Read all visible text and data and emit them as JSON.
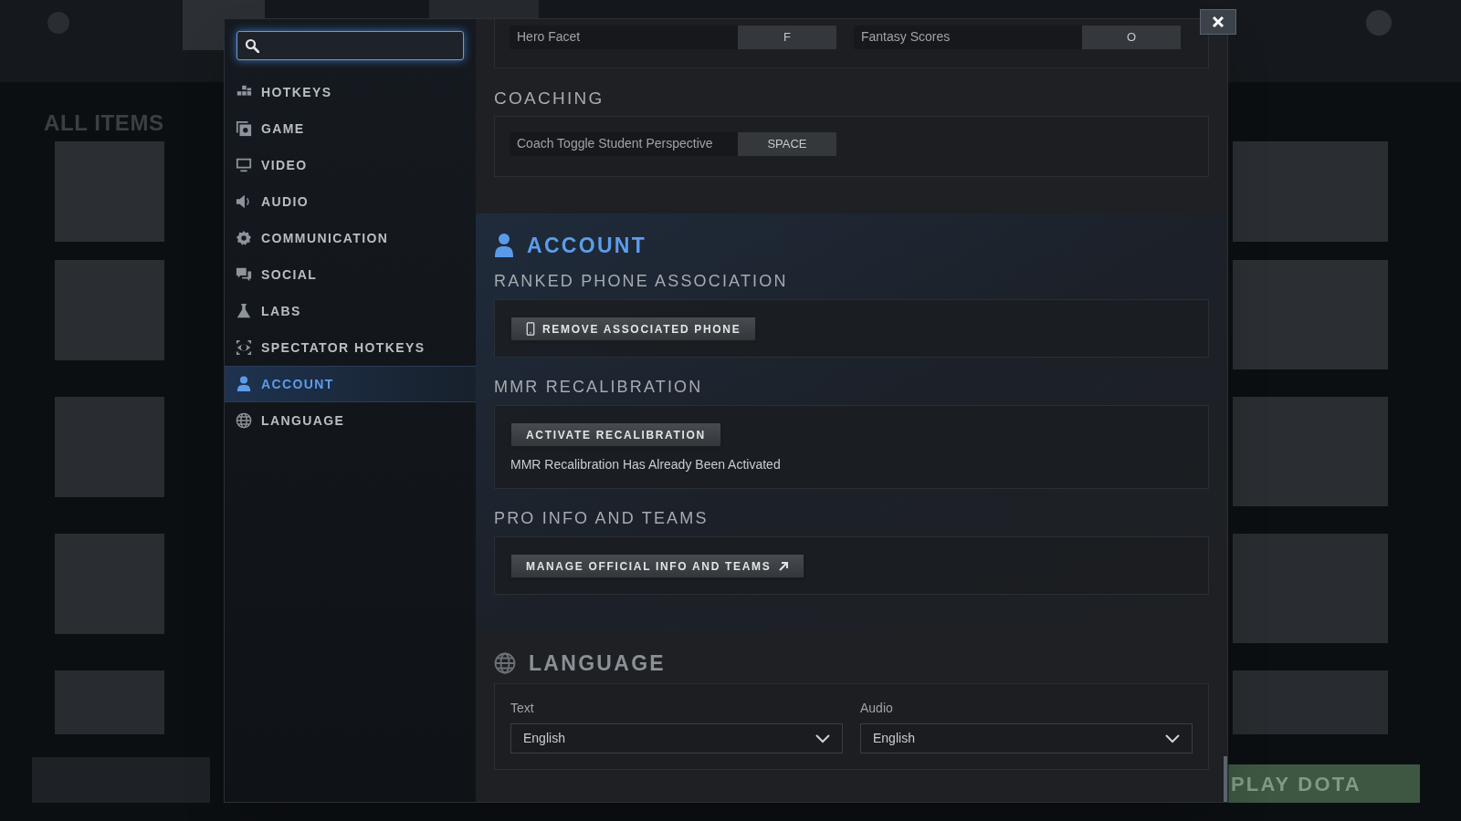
{
  "background": {
    "heading": "ALL ITEMS",
    "play_button": "PLAY DOTA"
  },
  "sidebar": {
    "items": [
      {
        "label": "HOTKEYS",
        "selected": false
      },
      {
        "label": "GAME",
        "selected": false
      },
      {
        "label": "VIDEO",
        "selected": false
      },
      {
        "label": "AUDIO",
        "selected": false
      },
      {
        "label": "COMMUNICATION",
        "selected": false
      },
      {
        "label": "SOCIAL",
        "selected": false
      },
      {
        "label": "LABS",
        "selected": false
      },
      {
        "label": "SPECTATOR HOTKEYS",
        "selected": false
      },
      {
        "label": "ACCOUNT",
        "selected": true
      },
      {
        "label": "LANGUAGE",
        "selected": false
      }
    ]
  },
  "hotkeys": {
    "rows": [
      {
        "label": "Hero Facet",
        "key": "F"
      },
      {
        "label": "Fantasy Scores",
        "key": "O"
      }
    ]
  },
  "coaching": {
    "title": "COACHING",
    "rows": [
      {
        "label": "Coach Toggle Student Perspective",
        "key": "SPACE"
      }
    ]
  },
  "account": {
    "title": "ACCOUNT",
    "groups": [
      {
        "title": "RANKED PHONE ASSOCIATION",
        "button": "REMOVE ASSOCIATED PHONE"
      },
      {
        "title": "MMR RECALIBRATION",
        "button": "ACTIVATE RECALIBRATION",
        "note": "MMR Recalibration Has Already Been Activated"
      },
      {
        "title": "PRO INFO AND TEAMS",
        "button": "MANAGE OFFICIAL INFO AND TEAMS"
      }
    ]
  },
  "language": {
    "title": "LANGUAGE",
    "fields": [
      {
        "label": "Text",
        "value": "English"
      },
      {
        "label": "Audio",
        "value": "English"
      }
    ]
  }
}
